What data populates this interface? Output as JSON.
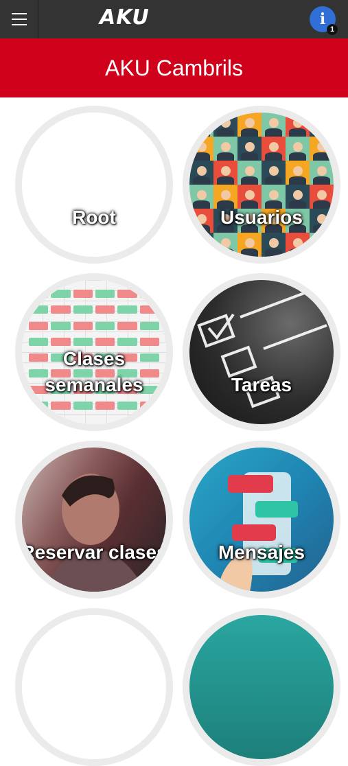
{
  "app": {
    "logo_text": "AKU",
    "page_title": "AKU Cambrils",
    "notification_count": "1"
  },
  "colors": {
    "topbar": "#333333",
    "title_bar": "#d0021b",
    "info_button": "#2f6fd6",
    "tile_ring": "#ebebeb"
  },
  "icons": {
    "menu": "hamburger-menu-icon",
    "info": "info-icon"
  },
  "tiles": [
    {
      "label_lines": [
        "Root"
      ],
      "art": "blank"
    },
    {
      "label_lines": [
        "Usuarios"
      ],
      "art": "people-avatars-grid"
    },
    {
      "label_lines": [
        "Clases",
        "semanales"
      ],
      "art": "weekly-schedule"
    },
    {
      "label_lines": [
        "Tareas"
      ],
      "art": "checkboxes-chalkboard"
    },
    {
      "label_lines": [
        "Reservar clases"
      ],
      "art": "smiling-man-photo"
    },
    {
      "label_lines": [
        "Mensajes"
      ],
      "art": "chat-bubbles-phone"
    }
  ]
}
